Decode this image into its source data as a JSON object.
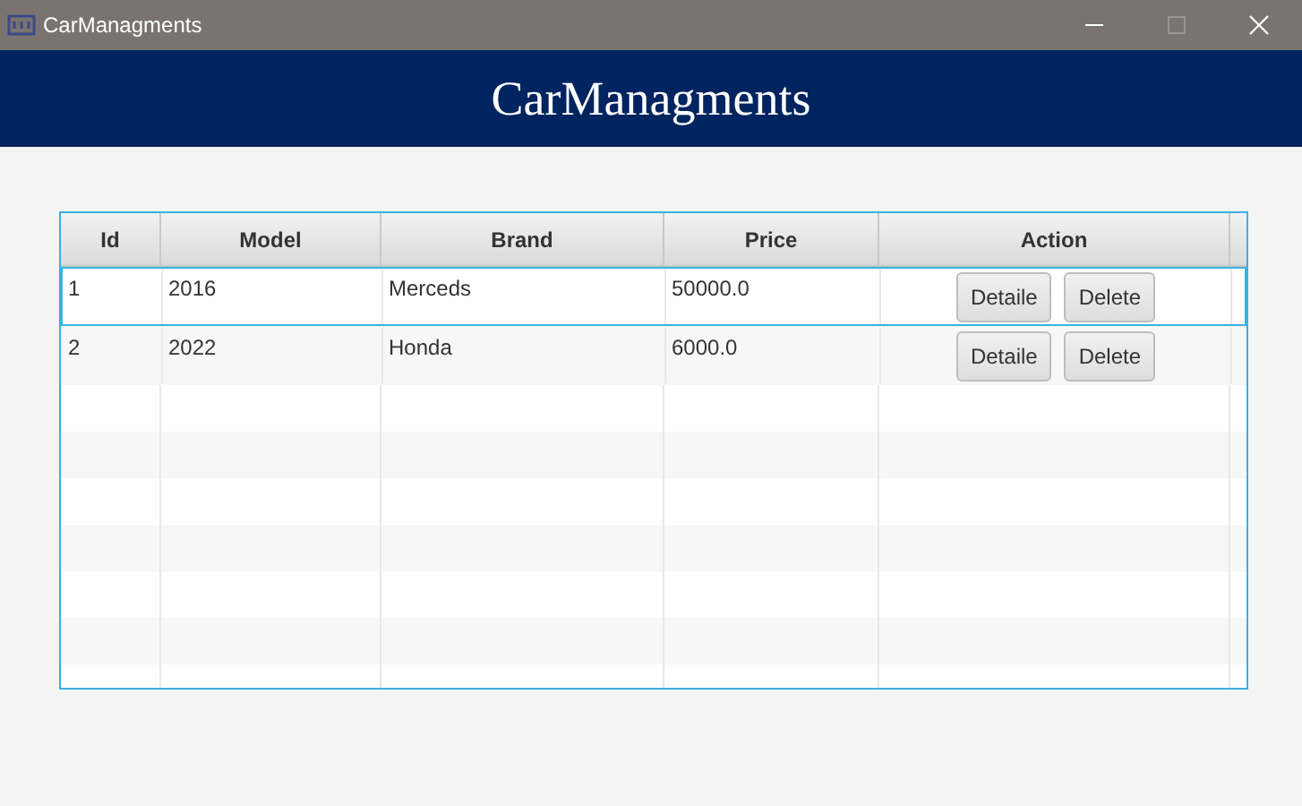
{
  "window": {
    "title": "CarManagments"
  },
  "header": {
    "title": "CarManagments"
  },
  "table": {
    "columns": [
      "Id",
      "Model",
      "Brand",
      "Price",
      "Action"
    ],
    "rows": [
      {
        "id": "1",
        "model": "2016",
        "brand": "Merceds",
        "price": "50000.0",
        "actions": [
          "Detaile",
          "Delete"
        ],
        "selected": true
      },
      {
        "id": "2",
        "model": "2022",
        "brand": "Honda",
        "price": "6000.0",
        "actions": [
          "Detaile",
          "Delete"
        ],
        "selected": false
      }
    ]
  }
}
